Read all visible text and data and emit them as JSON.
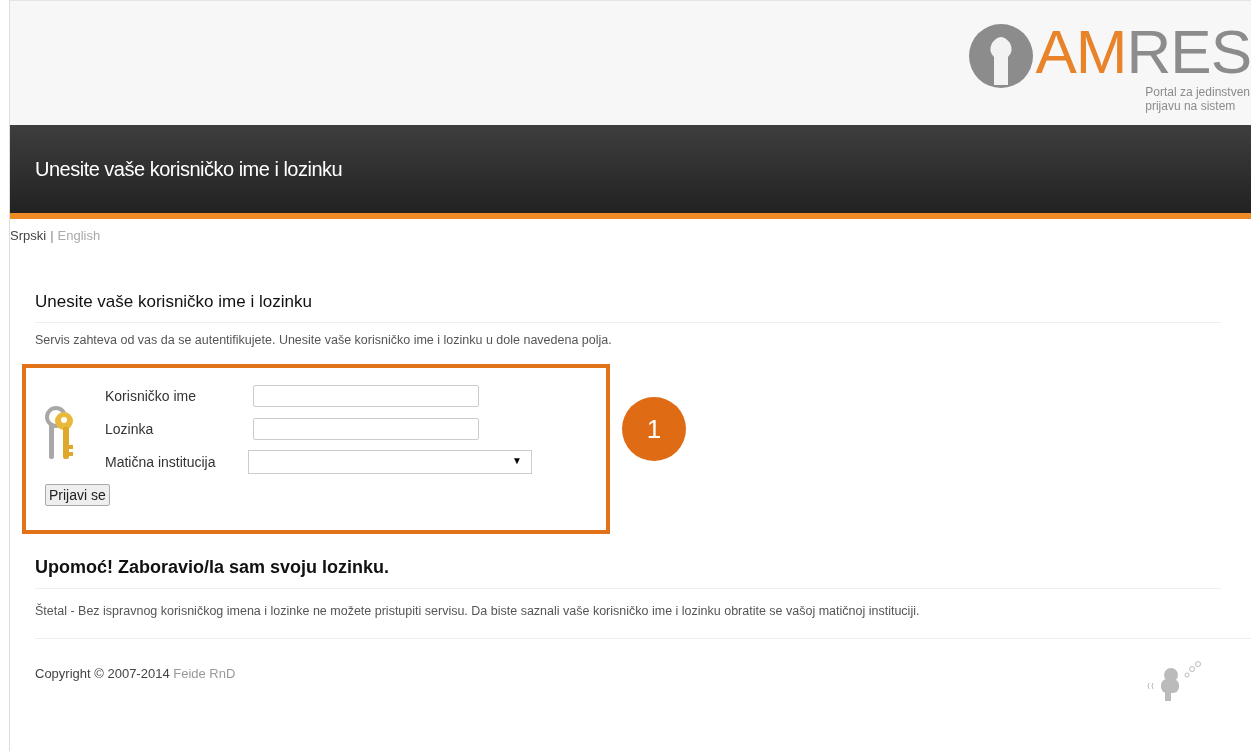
{
  "header": {
    "logo_parts": [
      {
        "text": "AM",
        "color": "#e8832a"
      },
      {
        "text": "RES",
        "color": "#8c8c8c"
      }
    ],
    "tagline_lines": [
      "Portal za jedinstven",
      "prijavu na sistem"
    ]
  },
  "banner": {
    "title": "Unesite vaše korisničko ime i lozinku"
  },
  "languages": [
    {
      "label": "Srpski",
      "selected": true
    },
    {
      "label": "English",
      "selected": false
    }
  ],
  "language_separator": "|",
  "login": {
    "heading": "Unesite vaše korisničko ime i lozinku",
    "intro": "Servis zahteva od vas da se autentifikujete. Unesite vaše korisničko ime i lozinku u dole navedena polja.",
    "fields": [
      {
        "label": "Korisničko ime",
        "kind": "text"
      },
      {
        "label": "Lozinka",
        "kind": "password"
      },
      {
        "label": "Matična institucija",
        "kind": "select"
      }
    ],
    "dropdown_arrow": "▼",
    "submit": "Prijavi se",
    "callout": "1"
  },
  "help": {
    "heading": "Upomoć! Zaboravio/la sam svoju lozinku.",
    "text": "Štetal - Bez ispravnog korisničkog imena i lozinke ne možete pristupiti servisu. Da biste saznali vaše korisničko ime i lozinku obratite se vašoj matičnoj instituciji."
  },
  "footer": {
    "copyright": "Copyright © 2007-2014",
    "link": "Feide RnD"
  }
}
